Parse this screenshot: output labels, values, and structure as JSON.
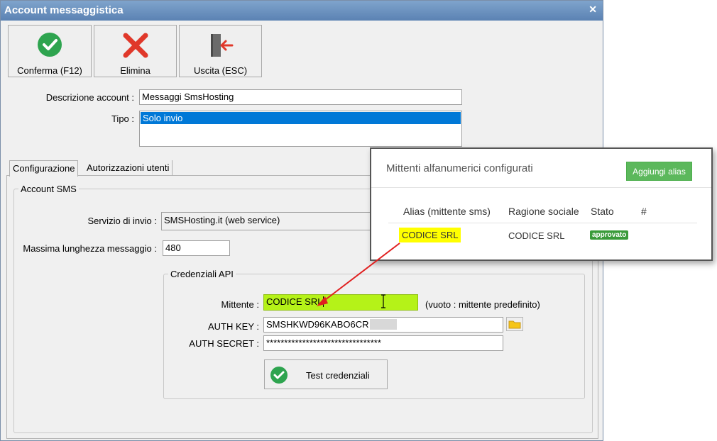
{
  "window": {
    "title": "Account messaggistica",
    "close_glyph": "✕"
  },
  "toolbar": {
    "confirm": {
      "label": "Conferma (F12)",
      "icon": "check-circle-icon"
    },
    "delete": {
      "label": "Elimina",
      "icon": "red-x-icon"
    },
    "exit": {
      "label": "Uscita (ESC)",
      "icon": "exit-door-icon"
    }
  },
  "account": {
    "description_label": "Descrizione account :",
    "description_value": "Messaggi SmsHosting",
    "type_label": "Tipo :",
    "type_selected": "Solo invio"
  },
  "tabs": [
    {
      "label": "Configurazione",
      "active": true
    },
    {
      "label": "Autorizzazioni utenti",
      "active": false
    }
  ],
  "sms": {
    "group_title": "Account SMS",
    "service_label": "Servizio di invio :",
    "service_value": "SMSHosting.it (web service)",
    "maxlen_label": "Massima lunghezza messaggio :",
    "maxlen_value": "480"
  },
  "api": {
    "group_title": "Credenziali API",
    "sender_label": "Mittente :",
    "sender_value": "CODICE SRL",
    "sender_hint": "(vuoto : mittente predefinito)",
    "authkey_label": "AUTH KEY :",
    "authkey_value": "SMSHKWD96KABO6CR",
    "authsecret_label": "AUTH SECRET :",
    "authsecret_value": "********************************",
    "test_button": "Test credenziali"
  },
  "popup": {
    "title": "Mittenti alfanumerici configurati",
    "add_button": "Aggiungi alias",
    "columns": [
      "Alias (mittente sms)",
      "Ragione sociale",
      "Stato",
      "#"
    ],
    "row": {
      "alias": "CODICE SRL",
      "ragione_sociale": "CODICE SRL",
      "stato": "approvato"
    }
  },
  "colors": {
    "highlight_field": "#b5f218",
    "alias_highlight": "#ffff00",
    "status_green": "#3a9b3a",
    "arrow": "#e02020"
  }
}
